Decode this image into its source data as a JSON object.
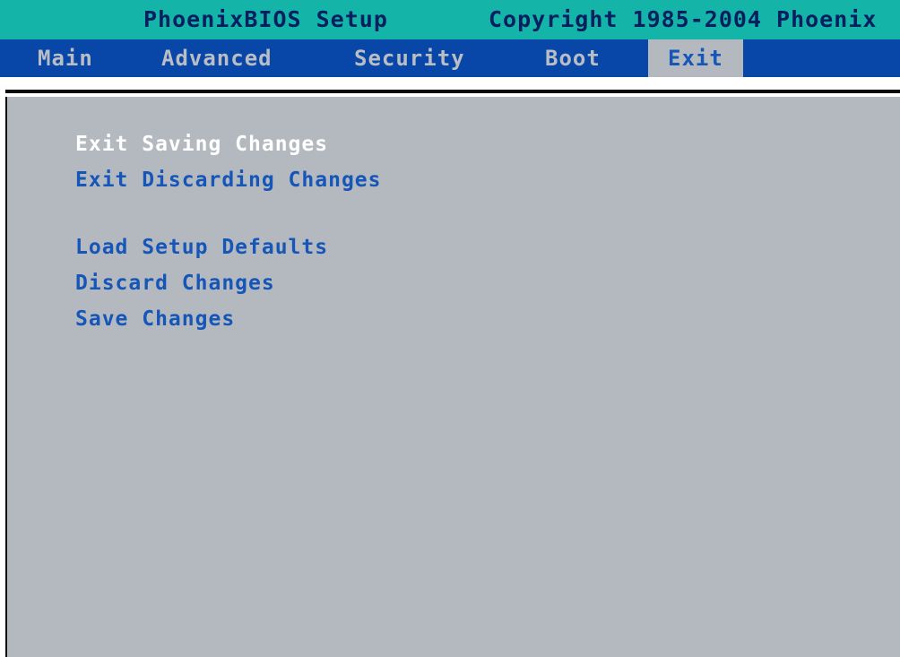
{
  "title_bar": {
    "title": "PhoenixBIOS Setup",
    "copyright": "Copyright 1985-2004 Phoenix"
  },
  "menu": {
    "tabs": [
      {
        "label": "Main"
      },
      {
        "label": "Advanced"
      },
      {
        "label": "Security"
      },
      {
        "label": "Boot"
      },
      {
        "label": "Exit",
        "selected": true
      }
    ]
  },
  "exit_menu": {
    "items": [
      {
        "label": "Exit Saving Changes",
        "highlighted": true
      },
      {
        "label": "Exit Discarding Changes"
      },
      {
        "label": "Load Setup Defaults"
      },
      {
        "label": "Discard Changes"
      },
      {
        "label": "Save Changes"
      }
    ]
  },
  "colors": {
    "title_bar_bg": "#15b4a8",
    "menu_bar_bg": "#0846a8",
    "panel_bg": "#b3b9bf",
    "item_text": "#1656b8",
    "highlight_text": "#ffffff"
  }
}
